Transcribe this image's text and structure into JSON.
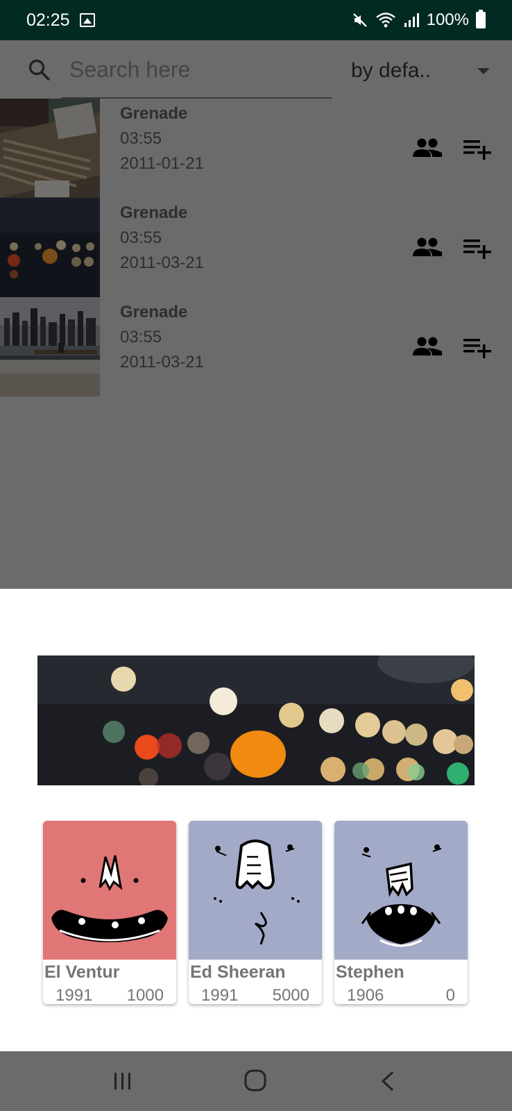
{
  "status_bar": {
    "time": "02:25",
    "battery": "100%",
    "icons": [
      "image-icon",
      "mute-icon",
      "wifi-icon",
      "signal-icon",
      "battery-icon"
    ]
  },
  "search": {
    "placeholder": "Search here",
    "value": ""
  },
  "sort": {
    "selected": "by defa.."
  },
  "songs": [
    {
      "title": "Grenade",
      "duration": "03:55",
      "date": "2011-01-21"
    },
    {
      "title": "Grenade",
      "duration": "03:55",
      "date": "2011-03-21"
    },
    {
      "title": "Grenade",
      "duration": "03:55",
      "date": "2011-03-21"
    }
  ],
  "artists": [
    {
      "name": "El Ventur",
      "year": "1991",
      "count": "1000",
      "color": "#e07675"
    },
    {
      "name": "Ed Sheeran",
      "year": "1991",
      "count": "5000",
      "color": "#a3aac8"
    },
    {
      "name": "Stephen",
      "year": "1906",
      "count": "0",
      "color": "#a3aac8"
    }
  ],
  "nav": {
    "icons": [
      "recents-icon",
      "home-icon",
      "back-icon"
    ]
  },
  "colors": {
    "status_bar": "#002a22",
    "scrim": "#6b6b6b",
    "sheet": "#ffffff"
  }
}
